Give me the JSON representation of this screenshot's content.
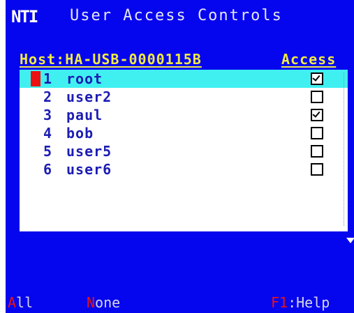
{
  "header": {
    "logo": "NTI",
    "title": "User Access Controls"
  },
  "host": {
    "label": "Host:HA-USB-0000115B",
    "access_label": "Access"
  },
  "users": [
    {
      "num": "1",
      "name": "root",
      "access": true,
      "selected": true
    },
    {
      "num": "2",
      "name": "user2",
      "access": false,
      "selected": false
    },
    {
      "num": "3",
      "name": "paul",
      "access": true,
      "selected": false
    },
    {
      "num": "4",
      "name": "bob",
      "access": false,
      "selected": false
    },
    {
      "num": "5",
      "name": "user5",
      "access": false,
      "selected": false
    },
    {
      "num": "6",
      "name": "user6",
      "access": false,
      "selected": false
    }
  ],
  "footer": {
    "all": {
      "hot": "A",
      "rest": "ll"
    },
    "none": {
      "hot": "N",
      "rest": "one"
    },
    "help": {
      "hot": "F1",
      "rest": ":Help"
    }
  },
  "colors": {
    "background": "#0606ee",
    "highlight": "#40f0f0",
    "hotkey": "#ee1111",
    "heading": "#f0ea42"
  }
}
